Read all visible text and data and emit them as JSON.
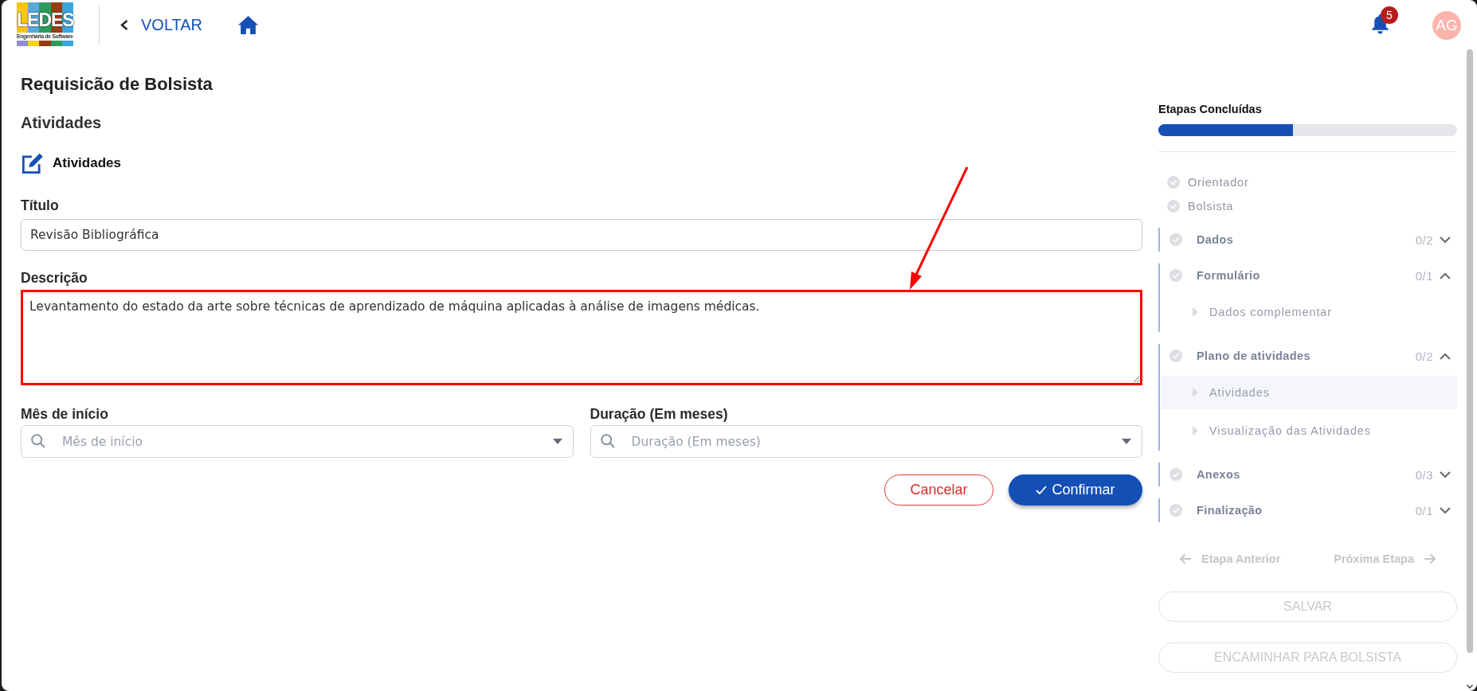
{
  "header": {
    "logo": {
      "name": "LEDES",
      "tagline": "Engenharia de Software"
    },
    "back_label": "VOLTAR",
    "notifications": "5",
    "avatar": "AG"
  },
  "page_title": "Requisicão de Bolsista",
  "section_title": "Atividades",
  "form": {
    "heading": "Atividades",
    "title_field": {
      "label": "Título",
      "value": "Revisão Bibliográfica"
    },
    "description_field": {
      "label": "Descrição",
      "value": "Levantamento do estado da arte sobre técnicas de aprendizado de máquina aplicadas à análise de imagens médicas.",
      "highlighted": true
    },
    "selects": [
      {
        "label": "Mês de início",
        "placeholder": "Mês de início"
      },
      {
        "label": "Duração (Em meses)",
        "placeholder": "Duração (Em meses)"
      }
    ],
    "buttons": [
      {
        "kind": "outline",
        "label": "Cancelar"
      },
      {
        "kind": "primary",
        "label": "Confirmar"
      }
    ]
  },
  "steps_panel": {
    "title": "Etapas Concluídas",
    "level": 0.45,
    "steps": [
      {
        "kind": "simple",
        "label": "Orientador",
        "done": false
      },
      {
        "kind": "simple",
        "label": "Bolsista",
        "done": false
      },
      {
        "kind": "group",
        "label": "Dados",
        "count": "0/2",
        "done": false,
        "expanded": false
      },
      {
        "kind": "group",
        "label": "Formulário",
        "count": "0/1",
        "done": false,
        "expanded": true,
        "children": [
          {
            "label": "Dados complementar",
            "selected": false
          }
        ]
      },
      {
        "kind": "group",
        "label": "Plano de atividades",
        "count": "0/2",
        "done": false,
        "expanded": true,
        "children": [
          {
            "label": "Atividades",
            "selected": true
          },
          {
            "label": "Visualização das Atividades",
            "selected": false
          }
        ]
      },
      {
        "kind": "group",
        "label": "Anexos",
        "count": "0/3",
        "done": false,
        "expanded": false
      },
      {
        "kind": "group",
        "label": "Finalização",
        "count": "0/1",
        "done": false,
        "expanded": false
      }
    ],
    "nav": [
      {
        "kind": "back",
        "label": "Etapa Anterior",
        "disabled": true
      },
      {
        "kind": "next",
        "label": "Próxima Etapa",
        "disabled": true
      }
    ],
    "actions": [
      {
        "label": "SALVAR",
        "disabled": true
      },
      {
        "label": "ENCAMINHAR PARA BOLSISTA",
        "disabled": true
      }
    ]
  }
}
